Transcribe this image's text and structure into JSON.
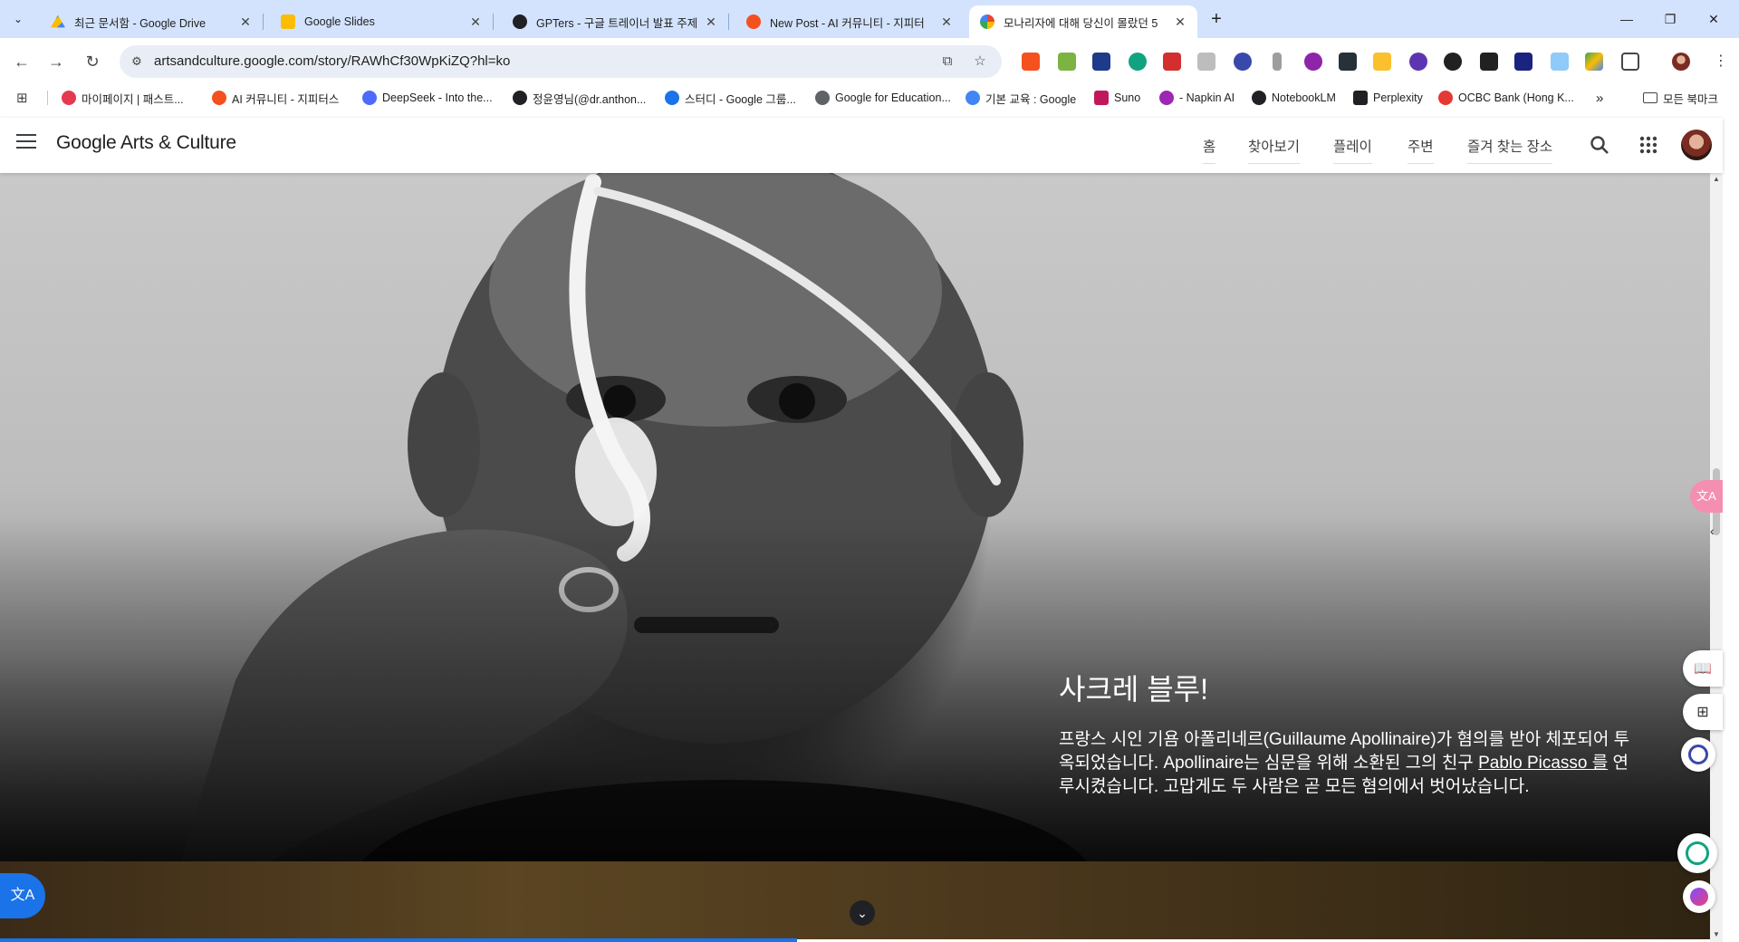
{
  "browser": {
    "tabs": [
      {
        "title": "최근 문서함 - Google Drive",
        "color": "#34a853"
      },
      {
        "title": "Google Slides",
        "color": "#fbbc04"
      },
      {
        "title": "GPTers - 구글 트레이너 발표 주제",
        "color": "#202124"
      },
      {
        "title": "New Post - AI 커뮤니티 - 지피터",
        "color": "#f4511e"
      },
      {
        "title": "모나리자에 대해 당신이 몰랐던 5",
        "color": "#ea4335"
      }
    ],
    "url": "artsandculture.google.com/story/RAWhCf30WpKiZQ?hl=ko",
    "bookmarks": [
      {
        "label": "마이페이지 | 패스트...",
        "color": "#e53950"
      },
      {
        "label": "AI 커뮤니티 - 지피터스",
        "color": "#f4511e"
      },
      {
        "label": "DeepSeek - Into the...",
        "color": "#4d6bfe"
      },
      {
        "label": "정윤영님(@dr.anthon...",
        "color": "#202124"
      },
      {
        "label": "스터디 - Google 그룹...",
        "color": "#1a73e8"
      },
      {
        "label": "Google for Education...",
        "color": "#5f6368"
      },
      {
        "label": "기본 교육 : Google",
        "color": "#4285f4"
      },
      {
        "label": "Suno",
        "color": "#c2185b"
      },
      {
        "label": "- Napkin AI",
        "color": "#9c27b0"
      },
      {
        "label": "NotebookLM",
        "color": "#202124"
      },
      {
        "label": "Perplexity",
        "color": "#202124"
      },
      {
        "label": "OCBC Bank (Hong K...",
        "color": "#e53935"
      }
    ],
    "all_bookmarks": "모든 북마크"
  },
  "site": {
    "brand": "Google Arts & Culture",
    "nav": [
      "홈",
      "찾아보기",
      "플레이",
      "주변",
      "즐겨 찾는 장소"
    ]
  },
  "story": {
    "title": "사크레 블루!",
    "body_1": "프랑스 시인 기욤 아폴리네르(Guillaume Apollinaire)가 혐의를 받아 체포되어 투옥되었습니다. Apollinaire는 심문을 위해 소환된 그의 친구 ",
    "link": "Pablo Picasso 를",
    "body_2": " 연루시켰습니다. 고맙게도 두 사람은 곧 모든 혐의에서 벗어났습니다."
  }
}
